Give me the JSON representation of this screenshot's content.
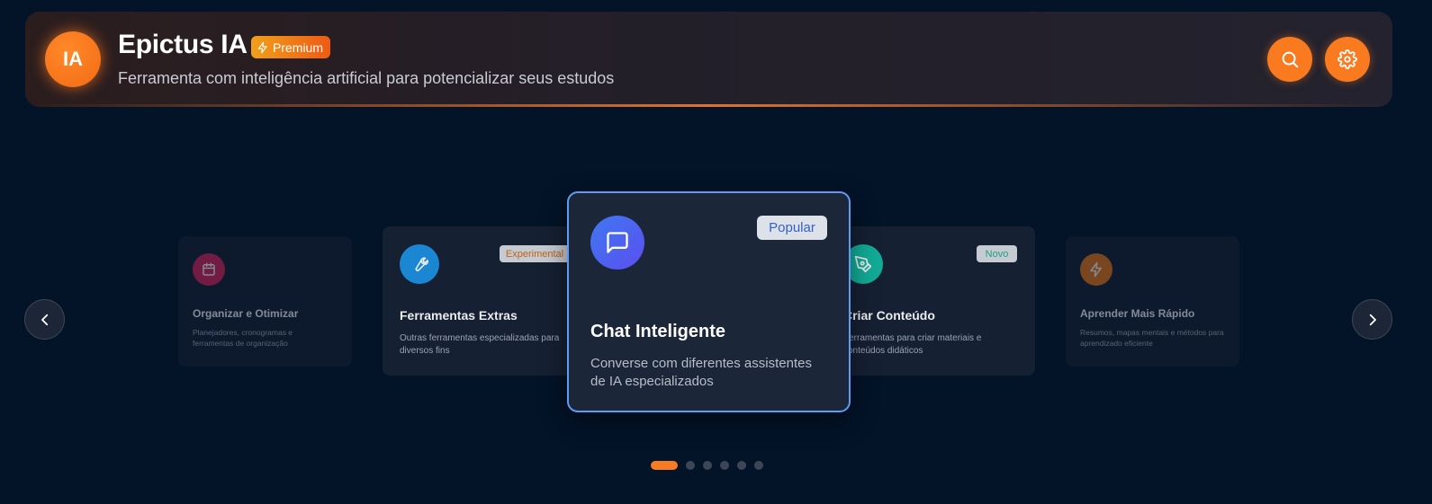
{
  "header": {
    "logo_text": "IA",
    "title": "Epictus IA",
    "badge": "Premium",
    "subtitle": "Ferramenta com inteligência artificial para potencializar seus estudos",
    "actions": [
      {
        "icon": "search-icon"
      },
      {
        "icon": "gear-icon"
      }
    ]
  },
  "carousel": {
    "cards": [
      {
        "title": "Organizar e Otimizar",
        "desc": "Planejadores, cronogramas e ferramentas de organização",
        "icon": "calendar-icon",
        "color": "#e0245e"
      },
      {
        "title": "Ferramentas Extras",
        "desc": "Outras ferramentas especializadas para diversos fins",
        "tag": "Experimental",
        "icon": "wrench-icon",
        "color": "#1e90e0"
      },
      {
        "title": "Chat Inteligente",
        "desc": "Converse com diferentes assistentes de IA especializados",
        "tag": "Popular",
        "icon": "chat-icon",
        "color": "#4a63f0"
      },
      {
        "title": "Criar Conteúdo",
        "desc": "Ferramentas para criar materiais e conteúdos didáticos",
        "tag": "Novo",
        "icon": "pen-icon",
        "color": "#14b8a0"
      },
      {
        "title": "Aprender Mais Rápido",
        "desc": "Resumos, mapas mentais e métodos para aprendizado eficiente",
        "icon": "bolt-icon",
        "color": "#f07a1a"
      }
    ],
    "active_index": 0,
    "page_count": 6
  },
  "colors": {
    "accent": "#fa7a20",
    "background": "#031328",
    "active_card_border": "#5f9bf2"
  }
}
